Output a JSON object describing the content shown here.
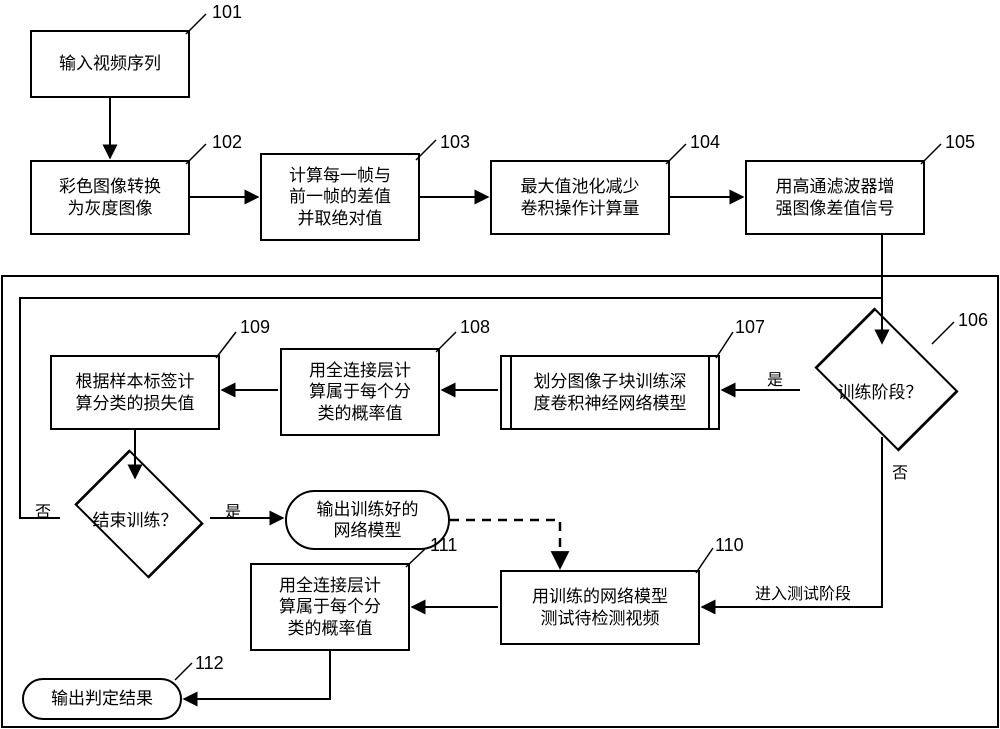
{
  "steps": {
    "s101": {
      "tag": "101",
      "text": "输入视频序列"
    },
    "s102": {
      "tag": "102",
      "text": "彩色图像转换\n为灰度图像"
    },
    "s103": {
      "tag": "103",
      "text": "计算每一帧与\n前一帧的差值\n并取绝对值"
    },
    "s104": {
      "tag": "104",
      "text": "最大值池化减少\n卷积操作计算量"
    },
    "s105": {
      "tag": "105",
      "text": "用高通滤波器增\n强图像差值信号"
    },
    "s106": {
      "tag": "106",
      "text": "训练阶段？"
    },
    "s107": {
      "tag": "107",
      "text": "划分图像子块训练深\n度卷积神经网络模型"
    },
    "s108": {
      "tag": "108",
      "text": "用全连接层计\n算属于每个分\n类的概率值"
    },
    "s109": {
      "tag": "109",
      "text": "根据样本标签计\n算分类的损失值"
    },
    "sEndTrain": {
      "text": "结束训练？"
    },
    "sOutModel": {
      "text": "输出训练好的\n网络模型"
    },
    "s110": {
      "tag": "110",
      "text": "用训练的网络模型\n测试待检测视频"
    },
    "s111": {
      "tag": "111",
      "text": "用全连接层计\n算属于每个分\n类的概率值"
    },
    "s112": {
      "tag": "112",
      "text": "输出判定结果"
    }
  },
  "edgeLabels": {
    "yes1": "是",
    "no1": "否",
    "yes2": "是",
    "no2": "否",
    "enterTest": "进入测试阶段"
  }
}
